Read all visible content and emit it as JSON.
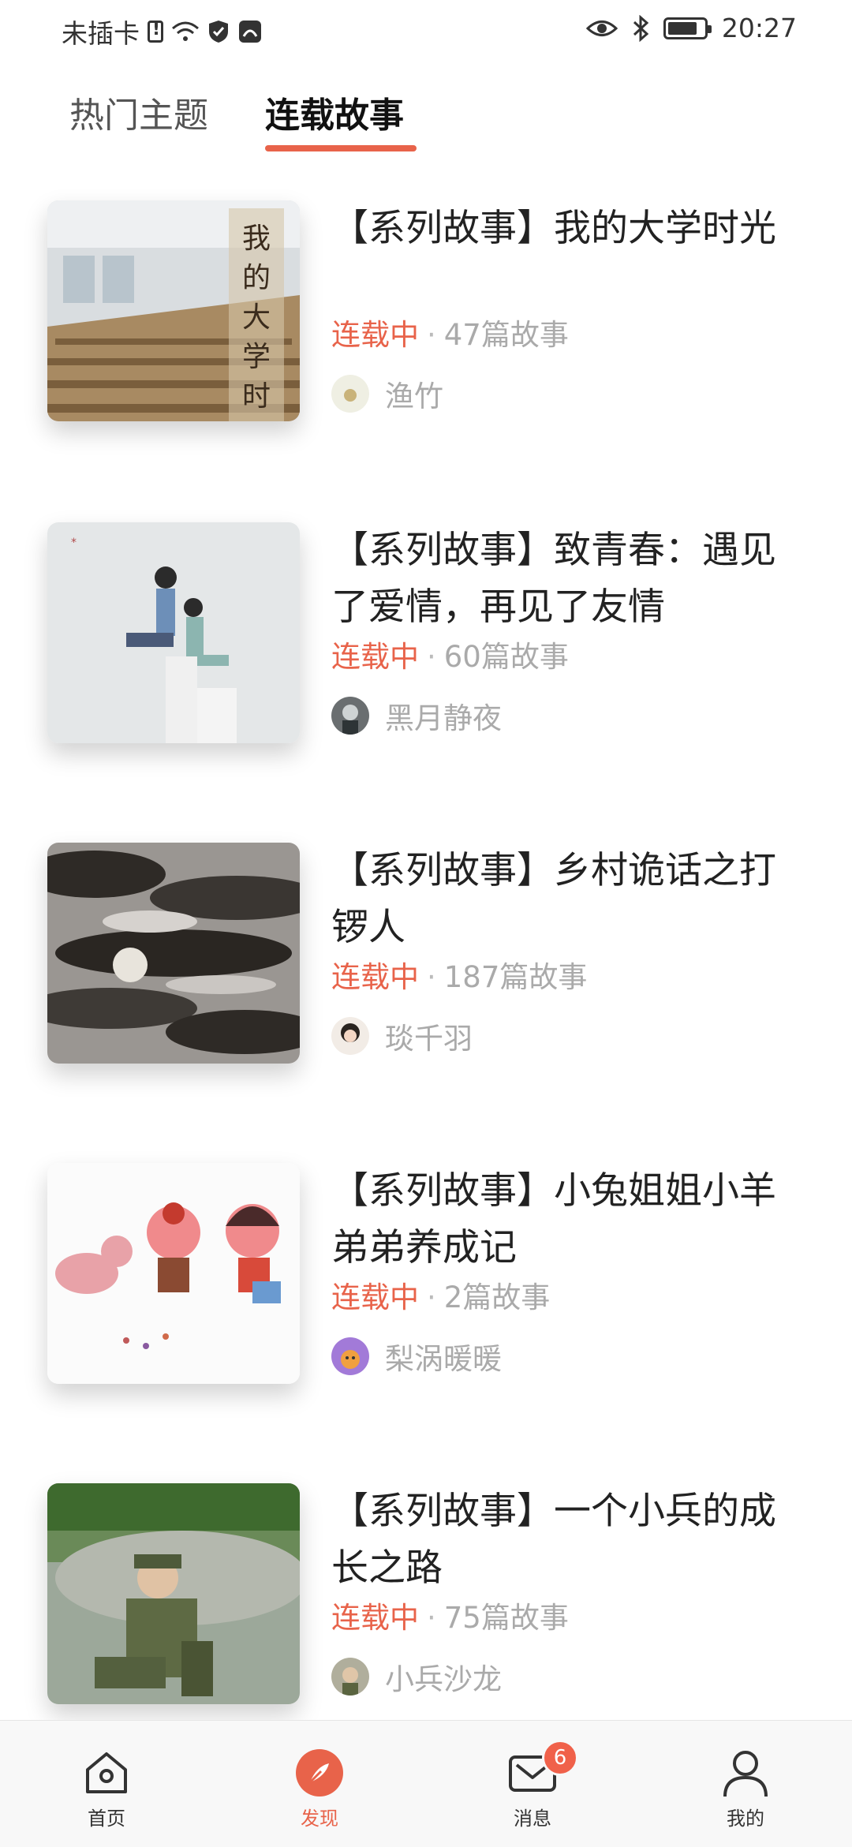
{
  "status_bar": {
    "carrier": "未插卡",
    "time": "20:27",
    "icons": [
      "sim-alert-icon",
      "wifi-icon",
      "shield-icon",
      "app-icon",
      "eye-icon",
      "bluetooth-icon",
      "battery-icon"
    ]
  },
  "tabs": [
    {
      "label": "热门主题",
      "active": false
    },
    {
      "label": "连载故事",
      "active": true
    }
  ],
  "accent_color": "#e8634a",
  "stories": [
    {
      "title": "【系列故事】我的大学时光",
      "status": "连载中",
      "separator": "·",
      "count": "47篇故事",
      "author": "渔竹"
    },
    {
      "title": "【系列故事】致青春：遇见了爱情，再见了友情",
      "status": "连载中",
      "separator": "·",
      "count": "60篇故事",
      "author": "黑月静夜"
    },
    {
      "title": "【系列故事】乡村诡话之打锣人",
      "status": "连载中",
      "separator": "·",
      "count": "187篇故事",
      "author": "琰千羽"
    },
    {
      "title": "【系列故事】小兔姐姐小羊弟弟养成记",
      "status": "连载中",
      "separator": "·",
      "count": "2篇故事",
      "author": "梨涡暖暖"
    },
    {
      "title": "【系列故事】一个小兵的成长之路",
      "status": "连载中",
      "separator": "·",
      "count": "75篇故事",
      "author": "小兵沙龙"
    }
  ],
  "bottom_nav": [
    {
      "label": "首页",
      "icon": "home-icon",
      "active": false
    },
    {
      "label": "发现",
      "icon": "compass-icon",
      "active": true
    },
    {
      "label": "消息",
      "icon": "mail-icon",
      "active": false,
      "badge": "6"
    },
    {
      "label": "我的",
      "icon": "user-icon",
      "active": false
    }
  ]
}
